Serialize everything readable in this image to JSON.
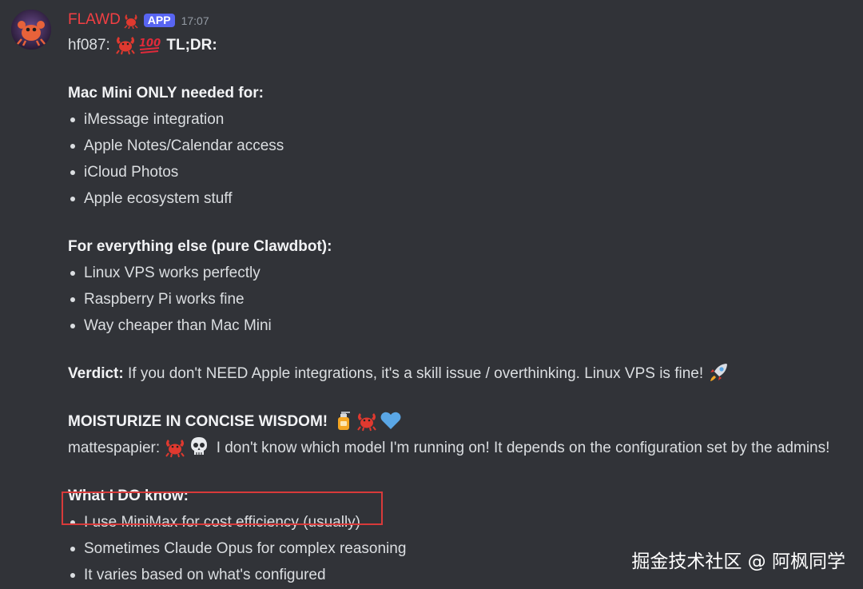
{
  "message": {
    "username": "FLAWD",
    "username_emoji": "crab-icon",
    "app_badge": "APP",
    "timestamp": "17:07",
    "reply_prefix": "hf087:",
    "reply_emojis": [
      "crab-icon",
      "hundred-points-icon"
    ],
    "tldr": "TL;DR:",
    "sections": {
      "mac_only": {
        "heading": "Mac Mini ONLY needed for:",
        "items": [
          "iMessage integration",
          "Apple Notes/Calendar access",
          "iCloud Photos",
          "Apple ecosystem stuff"
        ]
      },
      "everything_else": {
        "heading": "For everything else (pure Clawdbot):",
        "items": [
          "Linux VPS works perfectly",
          "Raspberry Pi works fine",
          "Way cheaper than Mac Mini"
        ]
      },
      "verdict": {
        "label": "Verdict:",
        "text": "If you don't NEED Apple integrations, it's a skill issue / overthinking. Linux VPS is fine!",
        "emoji": "rocket-icon"
      },
      "moisturize": {
        "text": "MOISTURIZE IN CONCISE WISDOM!",
        "emojis": [
          "lotion-bottle-icon",
          "crab-icon",
          "blue-heart-icon"
        ]
      },
      "reply2": {
        "prefix": "mattespapier:",
        "emojis": [
          "crab-icon",
          "skull-icon"
        ],
        "text": "I don't know which model I'm running on! It depends on the configuration set by the admins!"
      },
      "know": {
        "heading": "What I DO know:",
        "items": [
          "I use MiniMax for cost efficiency (usually)",
          "Sometimes Claude Opus for complex reasoning",
          "It varies based on what's configured"
        ]
      }
    }
  },
  "watermark": "掘金技术社区 @ 阿枫同学",
  "colors": {
    "background": "#313338",
    "username": "#f23f43",
    "badge": "#5865f2",
    "highlight_box": "#d83a3a"
  }
}
